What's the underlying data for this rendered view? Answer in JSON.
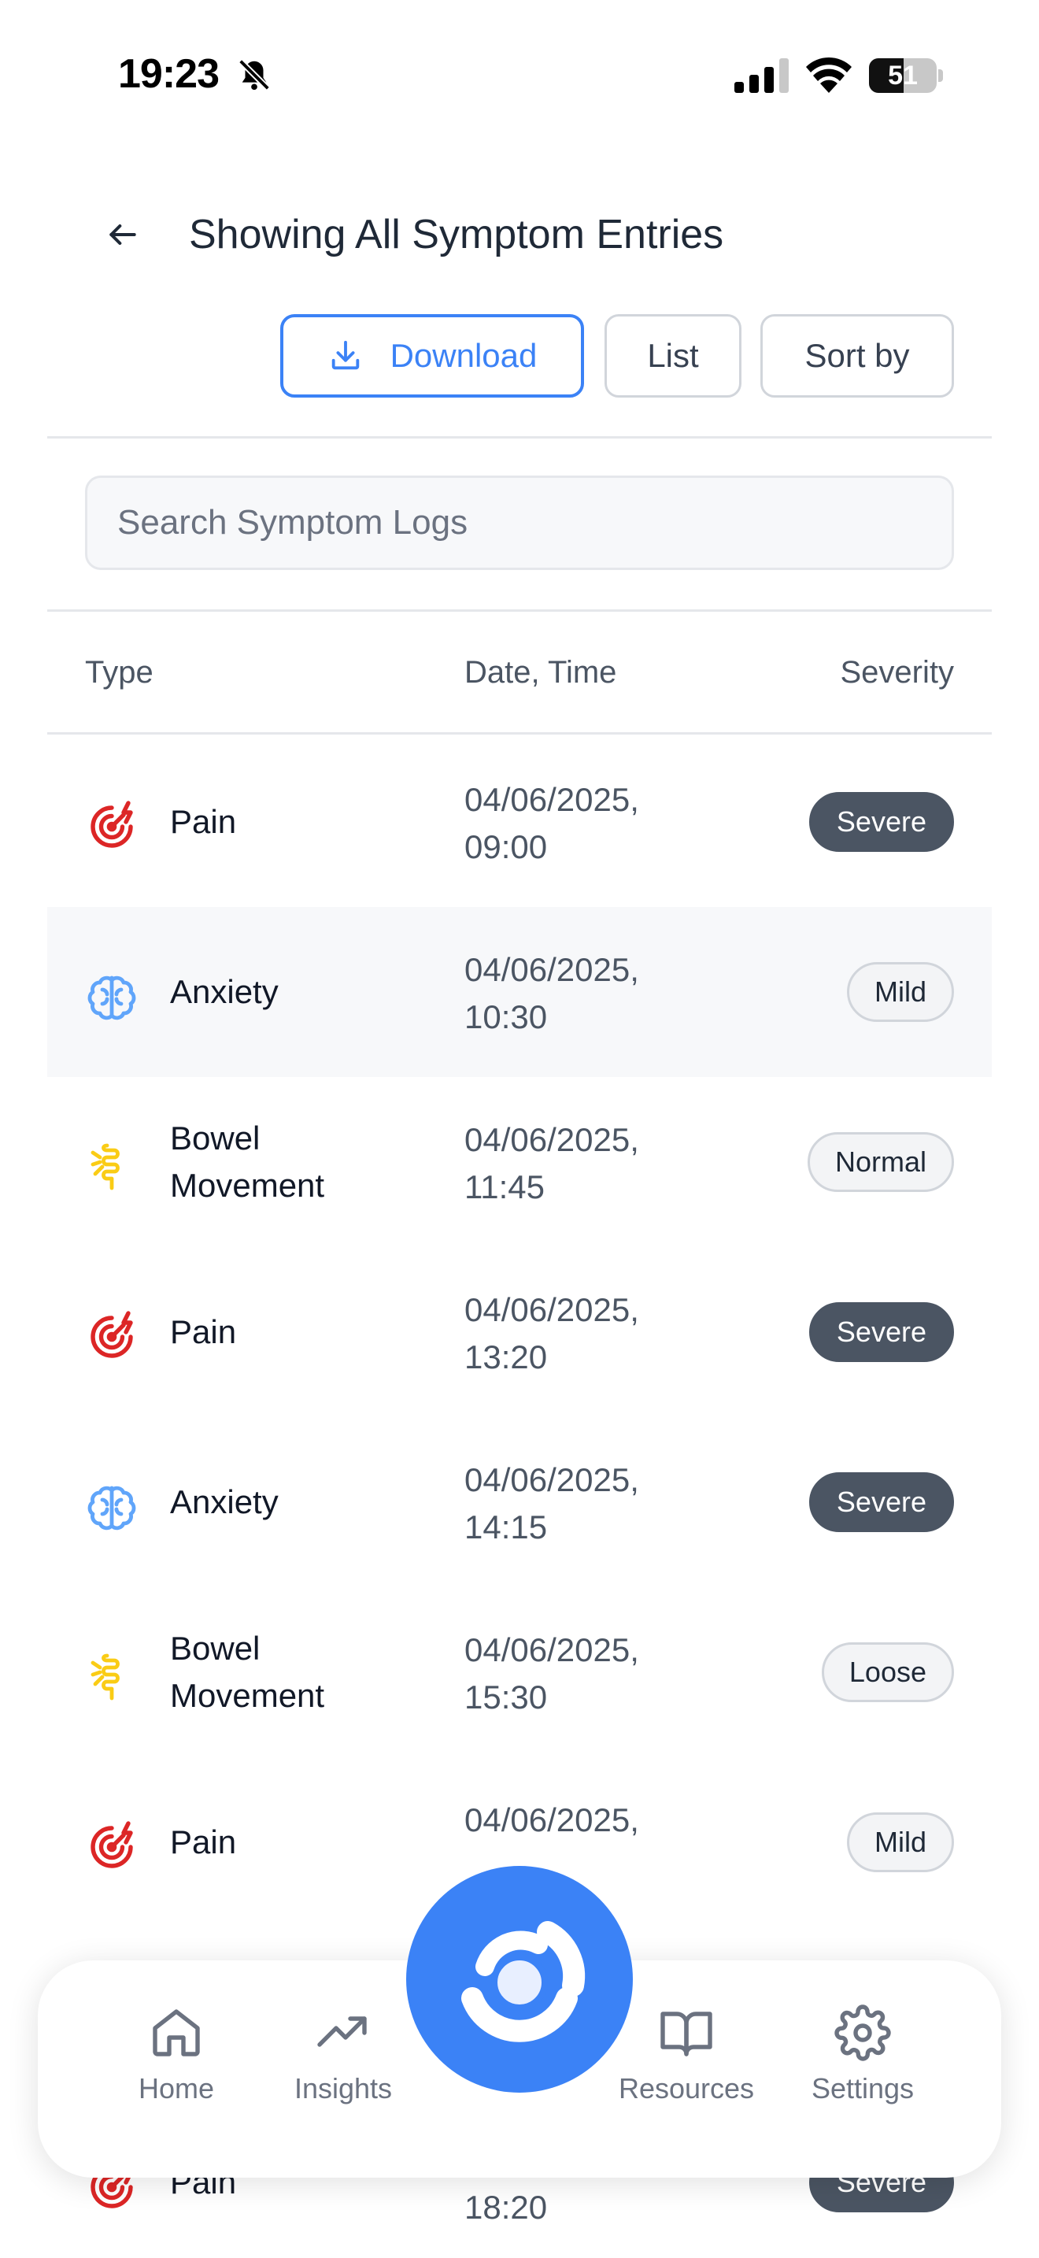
{
  "status_bar": {
    "time": "19:23",
    "battery": "51",
    "battery_fraction": 0.51,
    "icons": [
      "bell-slash-icon",
      "cellular-signal-icon",
      "wifi-icon",
      "battery-icon"
    ]
  },
  "header": {
    "title": "Showing All Symptom Entries",
    "back_icon": "arrow-left-icon"
  },
  "toolbar": {
    "download_label": "Download",
    "download_icon": "download-icon",
    "list_label": "List",
    "sort_label": "Sort by"
  },
  "search": {
    "placeholder": "Search Symptom Logs"
  },
  "table": {
    "headers": {
      "type": "Type",
      "date": "Date, Time",
      "severity": "Severity"
    },
    "rows": [
      {
        "type": "Pain",
        "icon": "target-pain-icon",
        "date": "04/06/2025,",
        "time": "09:00",
        "severity": "Severe"
      },
      {
        "type": "Anxiety",
        "icon": "brain-icon",
        "date": "04/06/2025,",
        "time": "10:30",
        "severity": "Mild"
      },
      {
        "type": "Bowel Movement",
        "icon": "intestine-icon",
        "date": "04/06/2025,",
        "time": "11:45",
        "severity": "Normal"
      },
      {
        "type": "Pain",
        "icon": "target-pain-icon",
        "date": "04/06/2025,",
        "time": "13:20",
        "severity": "Severe"
      },
      {
        "type": "Anxiety",
        "icon": "brain-icon",
        "date": "04/06/2025,",
        "time": "14:15",
        "severity": "Severe"
      },
      {
        "type": "Bowel Movement",
        "icon": "intestine-icon",
        "date": "04/06/2025,",
        "time": "15:30",
        "severity": "Loose"
      },
      {
        "type": "Pain",
        "icon": "target-pain-icon",
        "date": "04/06/2025,",
        "time": "",
        "severity": "Mild"
      },
      {
        "type": "",
        "icon": "",
        "date": "",
        "time": "",
        "severity": ""
      },
      {
        "type": "Pain",
        "icon": "target-pain-icon",
        "date": "",
        "time": "18:20",
        "severity": "Severe"
      }
    ]
  },
  "nav": {
    "home": "Home",
    "insights": "Insights",
    "resources": "Resources",
    "settings": "Settings",
    "fab_icon": "app-logo-icon"
  },
  "colors": {
    "accent": "#3b82f6",
    "badge_dark": "#4b5563",
    "pain": "#dc2626",
    "anxiety": "#60a5fa",
    "bowel": "#facc15"
  }
}
